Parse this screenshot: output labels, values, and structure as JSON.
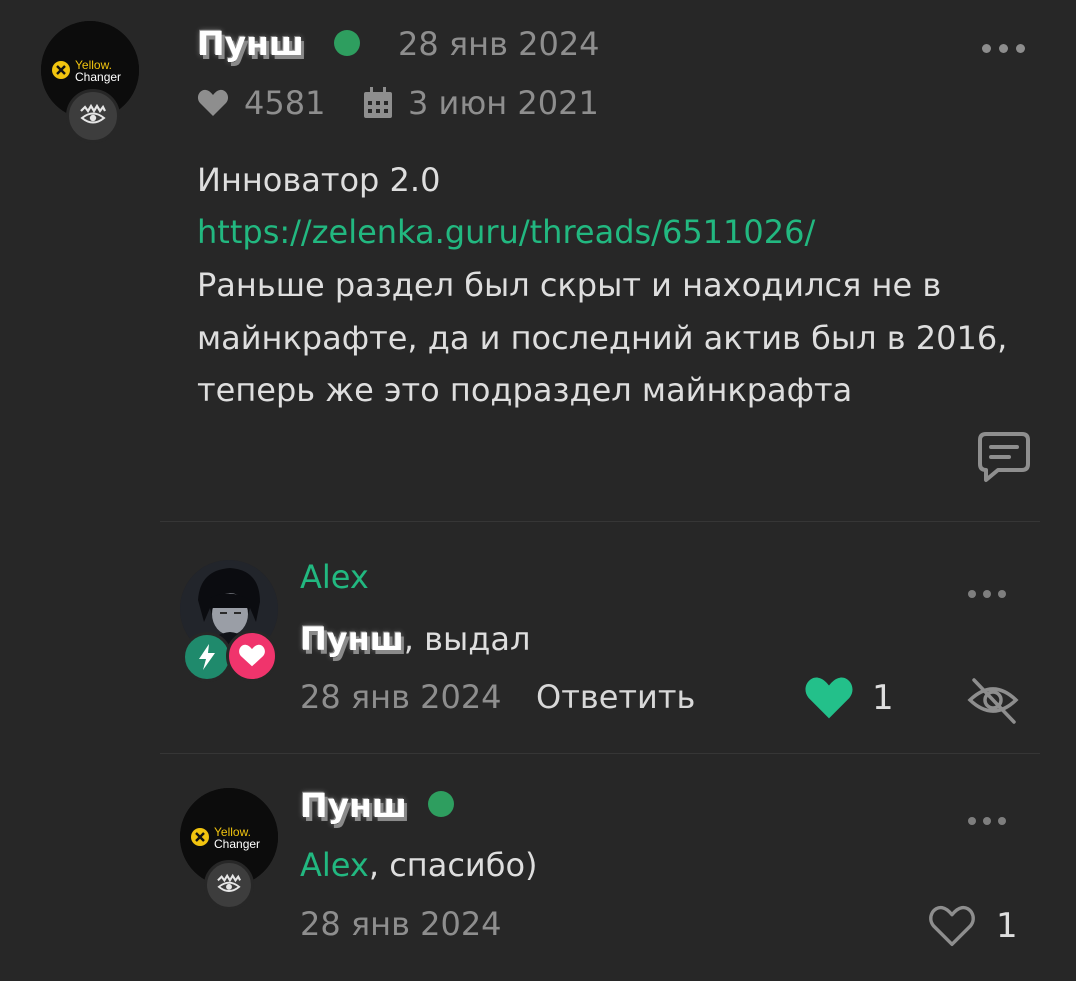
{
  "post": {
    "author": "Пунш",
    "date": "28 янв 2024",
    "likes": "4581",
    "registered": "3 июн 2021",
    "avatar_logo_line1": "Yellow.",
    "avatar_logo_line2": "Changer",
    "lines": [
      "Инноватор 2.0",
      "https://zelenka.guru/threads/6511026/",
      "Раньше раздел был скрыт и находился не в",
      "майнкрафте, да и последний актив был в 2016,",
      "теперь же это подраздел майнкрафта"
    ]
  },
  "comments": [
    {
      "author": "Alex",
      "mention": "Пунш",
      "text": ", выдал",
      "date": "28 янв 2024",
      "reply_label": "Ответить",
      "likes": "1",
      "liked": true
    },
    {
      "author": "Пунш",
      "mention": "Alex",
      "text": ", спасибо)",
      "date": "28 янв 2024",
      "likes": "1",
      "liked": false,
      "avatar_logo_line1": "Yellow.",
      "avatar_logo_line2": "Changer"
    }
  ],
  "icons": {
    "heart": "heart-icon",
    "calendar": "calendar-icon",
    "more": "more-icon",
    "comment": "comment-icon",
    "hide": "eye-off-icon",
    "eye_badge": "eye-badge-icon",
    "lightning": "lightning-icon"
  },
  "colors": {
    "background": "#272727",
    "accent_green": "#22b880",
    "online": "#2e9e5f",
    "like_active": "#23c08a",
    "badge_pink": "#f0346c",
    "badge_teal": "#1f8a6c"
  }
}
